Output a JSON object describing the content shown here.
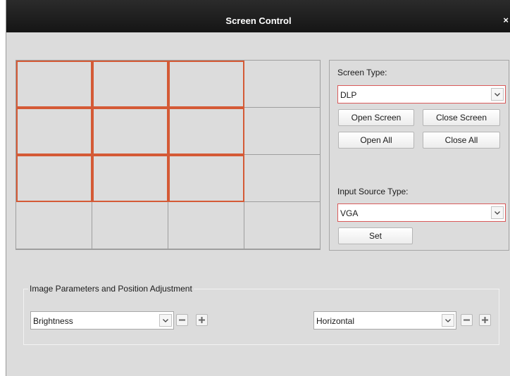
{
  "window": {
    "title": "Screen Control"
  },
  "wall": {
    "rows": 4,
    "cols": 4,
    "selected_rows": 3,
    "selected_cols": 3
  },
  "panel": {
    "screen_type_label": "Screen Type:",
    "screen_type_value": "DLP",
    "open_screen_label": "Open Screen",
    "close_screen_label": "Close Screen",
    "open_all_label": "Open All",
    "close_all_label": "Close All",
    "input_source_label": "Input Source Type:",
    "input_source_value": "VGA",
    "set_label": "Set"
  },
  "adjustment": {
    "group_label": "Image Parameters and Position Adjustment",
    "image_param_value": "Brightness",
    "position_value": "Horizontal"
  },
  "colors": {
    "selection_border": "#d45a36",
    "select_accent": "#d95a5a"
  }
}
